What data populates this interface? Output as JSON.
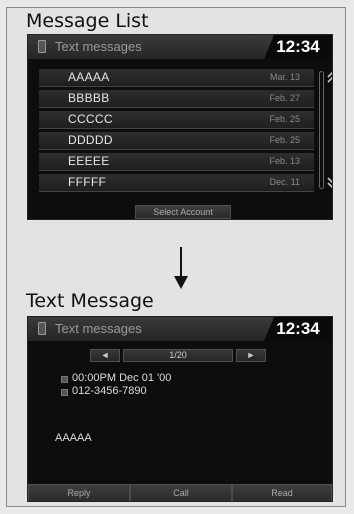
{
  "list_section": {
    "heading": "Message List",
    "header_title": "Text messages",
    "clock": "12:34",
    "messages": [
      {
        "name": "AAAAA",
        "date": "Mar. 13"
      },
      {
        "name": "BBBBB",
        "date": "Feb. 27"
      },
      {
        "name": "CCCCC",
        "date": "Feb. 25"
      },
      {
        "name": "DDDDD",
        "date": "Feb. 25"
      },
      {
        "name": "EEEEE",
        "date": "Feb. 13"
      },
      {
        "name": "FFFFF",
        "date": "Dec. 11"
      }
    ],
    "select_account_label": "Select Account",
    "scroll_up_icon": "double-chevron-up-icon",
    "scroll_down_icon": "double-chevron-down-icon"
  },
  "detail_section": {
    "heading": "Text Message",
    "header_title": "Text messages",
    "clock": "12:34",
    "page_indicator": "1/20",
    "timestamp": "00:00PM Dec 01 '00",
    "phone_number": "012-3456-7890",
    "body": "AAAAA",
    "buttons": {
      "reply": "Reply",
      "call": "Call",
      "read": "Read"
    }
  }
}
